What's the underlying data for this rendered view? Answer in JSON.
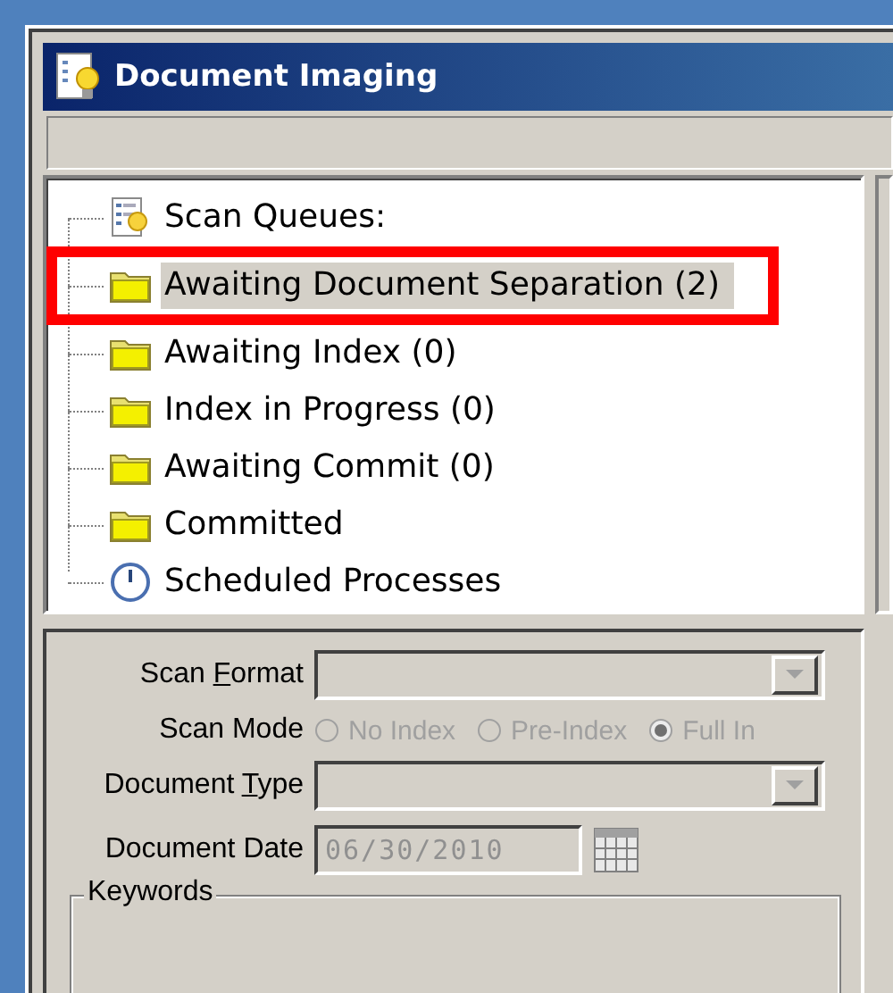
{
  "window": {
    "title": "Document Imaging"
  },
  "tree": {
    "label": "Scan Queues:",
    "kind": "queues",
    "children": [
      {
        "label": "Awaiting Document Separation (2)",
        "kind": "folder",
        "selected": true,
        "highlighted": true
      },
      {
        "label": "Awaiting Index (0)",
        "kind": "folder",
        "selected": false,
        "highlighted": false
      },
      {
        "label": "Index in Progress (0)",
        "kind": "folder",
        "selected": false,
        "highlighted": false
      },
      {
        "label": "Awaiting Commit (0)",
        "kind": "folder",
        "selected": false,
        "highlighted": false
      },
      {
        "label": "Committed",
        "kind": "folder",
        "selected": false,
        "highlighted": false
      },
      {
        "label": "Scheduled Processes",
        "kind": "clock",
        "selected": false,
        "highlighted": false
      }
    ]
  },
  "form": {
    "fields": [
      {
        "kind": "dropdown",
        "label_start": "Scan ",
        "mnemonic": "F",
        "label_end": "ormat",
        "disabled": true
      },
      {
        "kind": "radio",
        "label_start": "Scan Mode",
        "disabled": true,
        "options": [
          {
            "label": "No Index",
            "selected": false
          },
          {
            "label": "Pre-Index",
            "selected": false
          },
          {
            "label": "Full In",
            "selected": true
          }
        ]
      },
      {
        "kind": "dropdown",
        "label_start": "Document ",
        "mnemonic": "T",
        "label_end": "ype",
        "disabled": true
      },
      {
        "kind": "date",
        "label_start": "Document Date",
        "value": "06/30/2010",
        "disabled": true
      },
      {
        "kind": "group",
        "label_start": "Keywords"
      }
    ]
  }
}
